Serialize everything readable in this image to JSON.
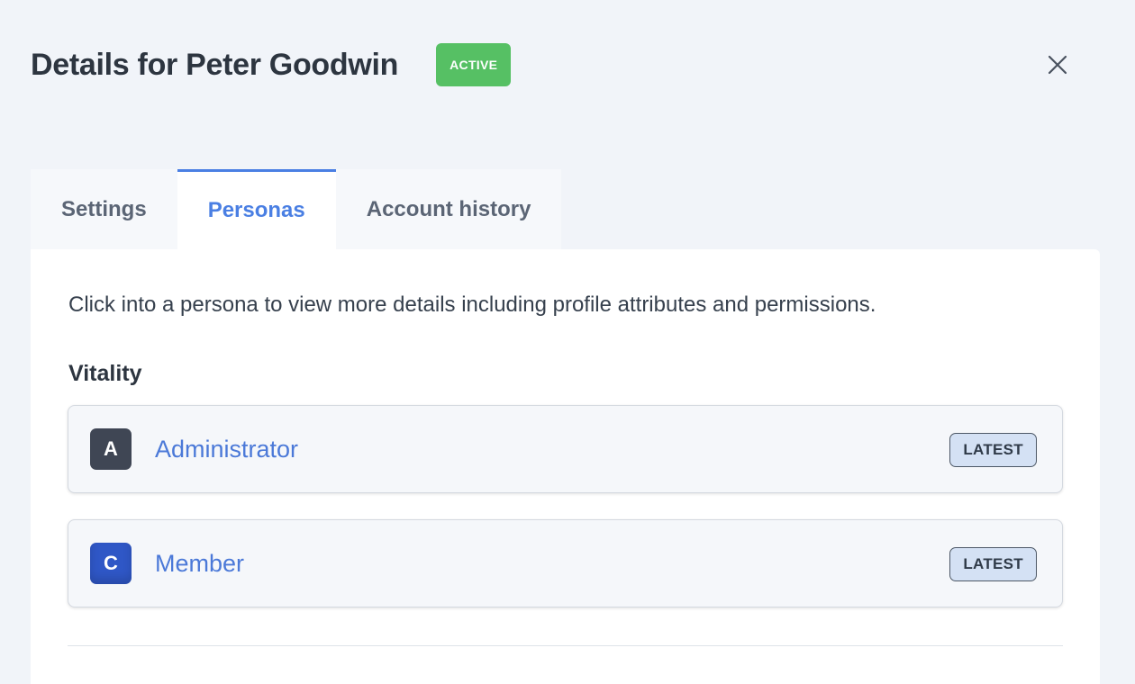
{
  "header": {
    "title": "Details for Peter Goodwin",
    "status": "ACTIVE",
    "close_label": "×"
  },
  "tabs": [
    {
      "label": "Settings",
      "active": false
    },
    {
      "label": "Personas",
      "active": true
    },
    {
      "label": "Account history",
      "active": false
    }
  ],
  "panel": {
    "intro": "Click into a persona to view more details including profile attributes and permissions.",
    "section_title": "Vitality",
    "personas": [
      {
        "initial": "A",
        "name": "Administrator",
        "badge": "LATEST",
        "avatar_color": "#3f4654"
      },
      {
        "initial": "C",
        "name": "Member",
        "badge": "LATEST",
        "avatar_color": "#2f57c6"
      }
    ]
  },
  "colors": {
    "accent": "#4a7fe3",
    "active_status": "#56c064",
    "badge_bg": "#d4e1f4"
  }
}
